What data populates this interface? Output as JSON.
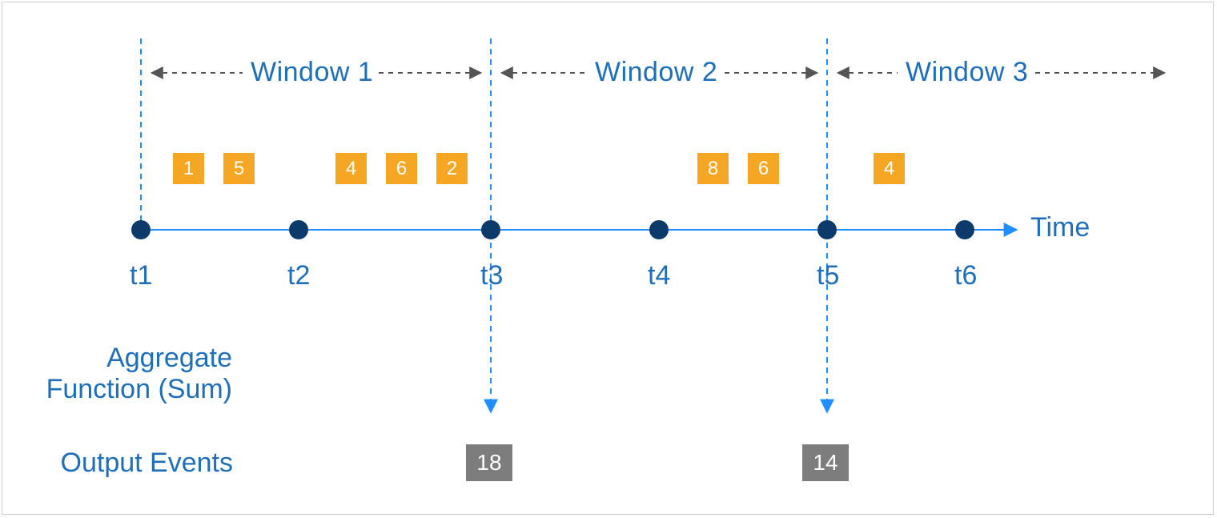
{
  "chart_data": {
    "type": "timeline",
    "title": "",
    "axis_label": "Time",
    "time_ticks": [
      "t1",
      "t2",
      "t3",
      "t4",
      "t5",
      "t6"
    ],
    "windows": [
      {
        "name": "Window 1",
        "start": "t1",
        "end": "t3",
        "events": [
          1,
          5,
          4,
          6,
          2
        ],
        "sum": 18
      },
      {
        "name": "Window 2",
        "start": "t3",
        "end": "t5",
        "events": [
          8,
          6
        ],
        "sum": 14
      },
      {
        "name": "Window 3",
        "start": "t5",
        "end": null,
        "events": [
          4
        ],
        "sum": null
      }
    ],
    "aggregate_function": "Sum",
    "output_events": [
      18,
      14
    ]
  },
  "labels": {
    "aggregate_line1": "Aggregate",
    "aggregate_line2": "Function (Sum)",
    "output_events": "Output Events",
    "time": "Time"
  },
  "windows": {
    "w1": "Window 1",
    "w2": "Window 2",
    "w3": "Window 3"
  },
  "ticks": {
    "t1": "t1",
    "t2": "t2",
    "t3": "t3",
    "t4": "t4",
    "t5": "t5",
    "t6": "t6"
  },
  "events": {
    "e1": "1",
    "e2": "5",
    "e3": "4",
    "e4": "6",
    "e5": "2",
    "e6": "8",
    "e7": "6",
    "e8": "4"
  },
  "outputs": {
    "o1": "18",
    "o2": "14"
  }
}
